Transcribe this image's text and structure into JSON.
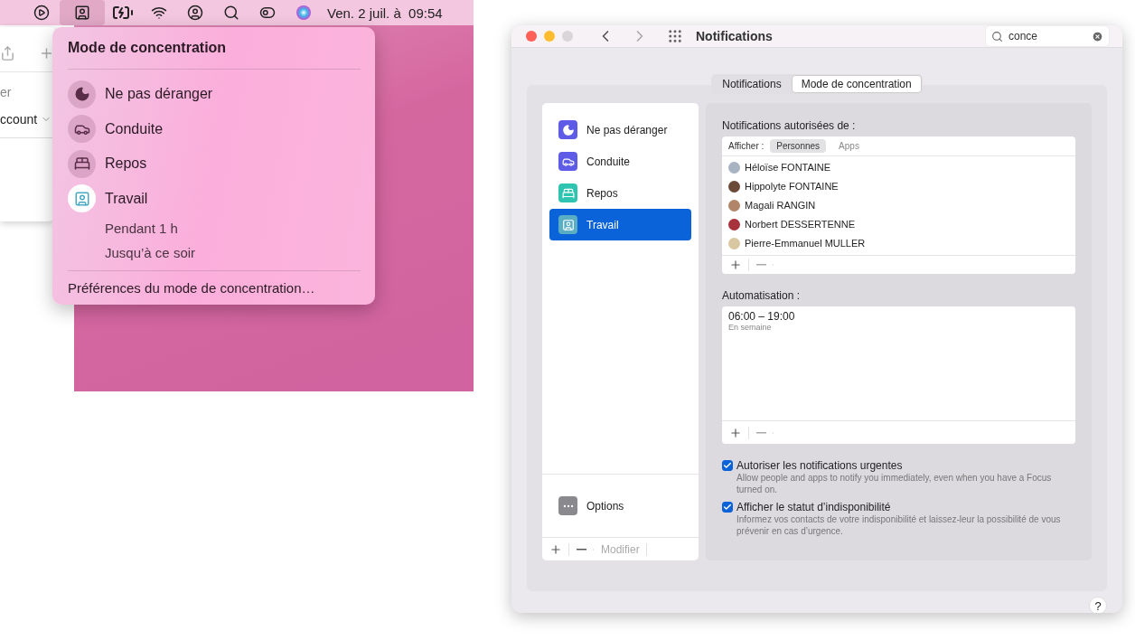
{
  "menu_bar": {
    "icons": [
      {
        "selected": false
      },
      {
        "selected": true
      },
      {
        "selected": false
      },
      {
        "selected": false
      },
      {
        "selected": false
      },
      {
        "selected": false
      },
      {
        "selected": false
      },
      {
        "selected": false
      }
    ],
    "clock": "Ven. 2 juil. à  09:54"
  },
  "background_app": {
    "texts": [
      "er",
      "ccount"
    ]
  },
  "focus_menu": {
    "title": "Mode de concentration",
    "modes": [
      {
        "label": "Ne pas déranger",
        "active": false
      },
      {
        "label": "Conduite",
        "active": false
      },
      {
        "label": "Repos",
        "active": false
      },
      {
        "label": "Travail",
        "active": true
      }
    ],
    "durations": [
      "Pendant 1 h",
      "Jusqu’à ce soir"
    ],
    "preferences": "Préférences du mode de concentration…"
  },
  "window": {
    "title": "Notifications",
    "search": {
      "value": "conce"
    },
    "tabs": [
      {
        "label": "Notifications",
        "selected": false
      },
      {
        "label": "Mode de concentration",
        "selected": true
      }
    ],
    "sidebar": {
      "items": [
        {
          "label": "Ne pas déranger",
          "selected": false,
          "color": "#5e5ce6"
        },
        {
          "label": "Conduite",
          "selected": false,
          "color": "#5e5ce6"
        },
        {
          "label": "Repos",
          "selected": false,
          "color": "#2ec4b0"
        },
        {
          "label": "Travail",
          "selected": true,
          "color": "#5aaec4"
        }
      ],
      "options": "Options",
      "edit": "Modifier"
    },
    "allowed": {
      "heading": "Notifications autorisées de :",
      "filter_label": "Afficher :",
      "filters": [
        {
          "label": "Personnes",
          "selected": true
        },
        {
          "label": "Apps",
          "selected": false
        }
      ],
      "people": [
        "Héloïse FONTAINE",
        "Hippolyte FONTAINE",
        "Magali RANGIN",
        "Norbert DESSERTENNE",
        "Pierre-Emmanuel MULLER"
      ]
    },
    "automation": {
      "heading": "Automatisation :",
      "entries": [
        {
          "time": "06:00 – 19:00",
          "days": "En semaine"
        }
      ]
    },
    "checks": [
      {
        "label": "Autoriser les notifications urgentes",
        "description": "Allow people and apps to notify you immediately, even when you have a Focus turned on.",
        "checked": true
      },
      {
        "label": "Afficher le statut d’indisponibilité",
        "description": "Informez vos contacts de votre indisponibilité et laissez-leur la possibilité de vous prévenir en cas d’urgence.",
        "checked": true
      }
    ],
    "help": "?"
  }
}
